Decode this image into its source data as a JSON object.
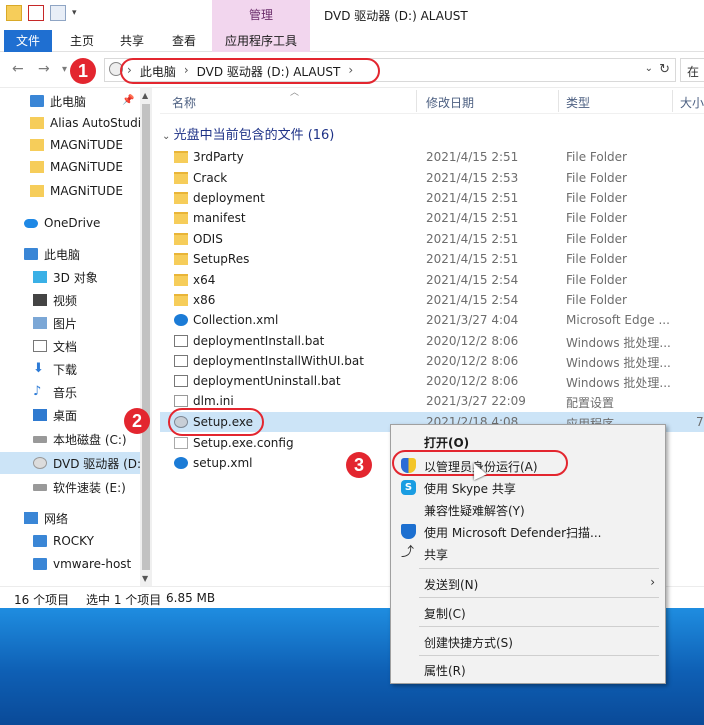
{
  "window": {
    "title": "DVD 驱动器 (D:) ALAUST",
    "context_tab_group": "管理"
  },
  "ribbon": {
    "tabs": [
      "文件",
      "主页",
      "共享",
      "查看",
      "应用程序工具"
    ]
  },
  "address": {
    "crumbs": [
      "此电脑",
      "DVD 驱动器 (D:) ALAUST"
    ],
    "search_placeholder": "在"
  },
  "sidebar": {
    "items": [
      {
        "label": "此电脑",
        "icon": "computer-icon"
      },
      {
        "label": "Alias AutoStudi",
        "icon": "folder-icon"
      },
      {
        "label": "MAGNiTUDE",
        "icon": "folder-icon"
      },
      {
        "label": "MAGNiTUDE",
        "icon": "folder-icon"
      },
      {
        "label": "MAGNiTUDE",
        "icon": "folder-icon"
      },
      {
        "label": "OneDrive",
        "icon": "cloud-icon"
      },
      {
        "label": "此电脑",
        "icon": "computer-icon"
      },
      {
        "label": "3D 对象",
        "icon": "cube-icon"
      },
      {
        "label": "视频",
        "icon": "video-icon"
      },
      {
        "label": "图片",
        "icon": "picture-icon"
      },
      {
        "label": "文档",
        "icon": "document-icon"
      },
      {
        "label": "下载",
        "icon": "download-icon"
      },
      {
        "label": "音乐",
        "icon": "music-icon"
      },
      {
        "label": "桌面",
        "icon": "desktop-icon"
      },
      {
        "label": "本地磁盘 (C:)",
        "icon": "drive-icon"
      },
      {
        "label": "DVD 驱动器 (D:",
        "icon": "dvd-icon"
      },
      {
        "label": "软件速装 (E:)",
        "icon": "drive-icon"
      },
      {
        "label": "网络",
        "icon": "network-icon"
      },
      {
        "label": "ROCKY",
        "icon": "computer-icon"
      },
      {
        "label": "vmware-host",
        "icon": "computer-icon"
      }
    ]
  },
  "columns": {
    "name": "名称",
    "date": "修改日期",
    "type": "类型",
    "size": "大小"
  },
  "group_header": "光盘中当前包含的文件 (16)",
  "files": [
    {
      "name": "3rdParty",
      "date": "2021/4/15 2:51",
      "type": "File Folder",
      "size": "",
      "icon": "folder-icon"
    },
    {
      "name": "Crack",
      "date": "2021/4/15 2:53",
      "type": "File Folder",
      "size": "",
      "icon": "folder-icon"
    },
    {
      "name": "deployment",
      "date": "2021/4/15 2:51",
      "type": "File Folder",
      "size": "",
      "icon": "folder-icon"
    },
    {
      "name": "manifest",
      "date": "2021/4/15 2:51",
      "type": "File Folder",
      "size": "",
      "icon": "folder-icon"
    },
    {
      "name": "ODIS",
      "date": "2021/4/15 2:51",
      "type": "File Folder",
      "size": "",
      "icon": "folder-icon"
    },
    {
      "name": "SetupRes",
      "date": "2021/4/15 2:51",
      "type": "File Folder",
      "size": "",
      "icon": "folder-icon"
    },
    {
      "name": "x64",
      "date": "2021/4/15 2:54",
      "type": "File Folder",
      "size": "",
      "icon": "folder-icon"
    },
    {
      "name": "x86",
      "date": "2021/4/15 2:54",
      "type": "File Folder",
      "size": "",
      "icon": "folder-icon"
    },
    {
      "name": "Collection.xml",
      "date": "2021/3/27 4:04",
      "type": "Microsoft Edge ...",
      "size": "",
      "icon": "edge-icon"
    },
    {
      "name": "deploymentInstall.bat",
      "date": "2020/12/2 8:06",
      "type": "Windows 批处理...",
      "size": "",
      "icon": "batch-file-icon"
    },
    {
      "name": "deploymentInstallWithUI.bat",
      "date": "2020/12/2 8:06",
      "type": "Windows 批处理...",
      "size": "",
      "icon": "batch-file-icon"
    },
    {
      "name": "deploymentUninstall.bat",
      "date": "2020/12/2 8:06",
      "type": "Windows 批处理...",
      "size": "",
      "icon": "batch-file-icon"
    },
    {
      "name": "dlm.ini",
      "date": "2021/3/27 22:09",
      "type": "配置设置",
      "size": "",
      "icon": "ini-file-icon"
    },
    {
      "name": "Setup.exe",
      "date": "2021/2/18 4:08",
      "type": "应用程序",
      "size": "7",
      "icon": "setup-exe-icon"
    },
    {
      "name": "Setup.exe.config",
      "date": "",
      "type": "",
      "size": "",
      "icon": "config-file-icon"
    },
    {
      "name": "setup.xml",
      "date": "",
      "type": "",
      "size": "",
      "icon": "edge-icon"
    }
  ],
  "status": {
    "count": "16 个项目",
    "selected": "选中 1 个项目",
    "size": "6.85 MB"
  },
  "context_menu": {
    "items": [
      {
        "label": "打开(O)",
        "icon": ""
      },
      {
        "label": "以管理员身份运行(A)",
        "icon": "uac-shield-icon"
      },
      {
        "label": "使用 Skype 共享",
        "icon": "skype-icon"
      },
      {
        "label": "兼容性疑难解答(Y)",
        "icon": ""
      },
      {
        "label": "使用 Microsoft Defender扫描...",
        "icon": "defender-icon"
      },
      {
        "label": "共享",
        "icon": "share-icon"
      },
      {
        "label": "发送到(N)",
        "icon": ""
      },
      {
        "label": "复制(C)",
        "icon": ""
      },
      {
        "label": "创建快捷方式(S)",
        "icon": ""
      },
      {
        "label": "属性(R)",
        "icon": ""
      }
    ]
  },
  "annotations": {
    "step1": "1",
    "step2": "2",
    "step3": "3",
    "color": "#e3262f"
  }
}
